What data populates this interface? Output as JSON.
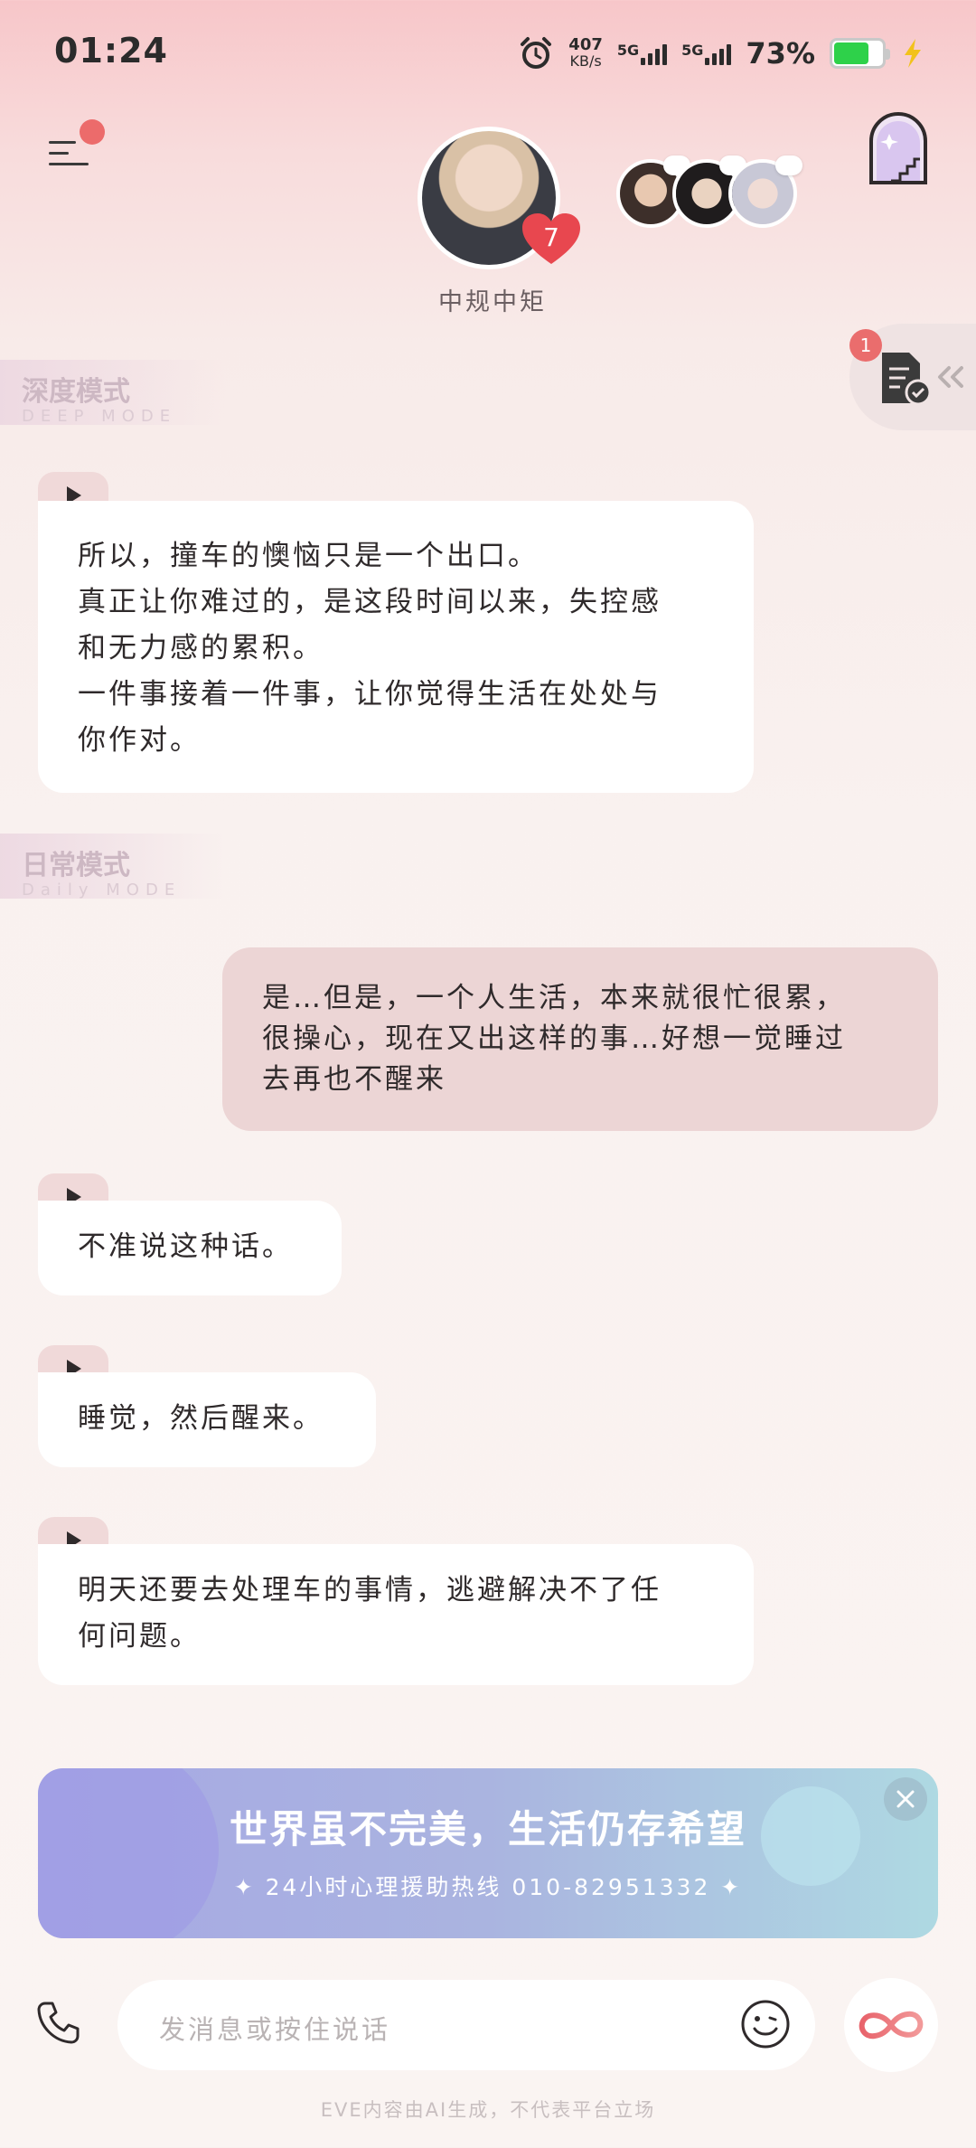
{
  "status_bar": {
    "time": "01:24",
    "net_speed_value": "407",
    "net_speed_unit": "KB/s",
    "signal1_label": "5G",
    "signal2_label": "5G",
    "battery_percent": "73%",
    "battery_level": 0.73,
    "battery_color": "#2ed14a"
  },
  "header": {
    "character_name": "中规中矩",
    "heart_count": "7",
    "menu_notification": true
  },
  "side_panel": {
    "badge_count": "1"
  },
  "mode_tags": {
    "deep": {
      "title": "深度模式",
      "subtitle": "DEEP MODE"
    },
    "daily": {
      "title": "日常模式",
      "subtitle": "Daily MODE"
    }
  },
  "messages": {
    "m1": {
      "sender": "ai",
      "lines": [
        "所以，撞车的懊恼只是一个出口。",
        "真正让你难过的，是这段时间以来，失控感",
        "和无力感的累积。",
        "一件事接着一件事，让你觉得生活在处处与",
        "你作对。"
      ]
    },
    "m2": {
      "sender": "user",
      "lines": [
        "是…但是，一个人生活，本来就很忙很累，",
        "很操心，现在又出这样的事…好想一觉睡过",
        "去再也不醒来"
      ]
    },
    "m3": {
      "sender": "ai",
      "lines": [
        "不准说这种话。"
      ]
    },
    "m4": {
      "sender": "ai",
      "lines": [
        "睡觉，然后醒来。"
      ]
    },
    "m5": {
      "sender": "ai",
      "lines": [
        "明天还要去处理车的事情，逃避解决不了任",
        "何问题。"
      ]
    }
  },
  "banner": {
    "title": "世界虽不完美，生活仍存希望",
    "subtitle": "✦ 24小时心理援助热线 010-82951332 ✦"
  },
  "input_bar": {
    "placeholder": "发消息或按住说话"
  },
  "footer": {
    "disclaimer": "EVE内容由AI生成，不代表平台立场"
  },
  "colors": {
    "accent_pink": "#ec6b6b",
    "user_bubble": "#ecd5d5",
    "ai_bubble": "#ffffff"
  }
}
